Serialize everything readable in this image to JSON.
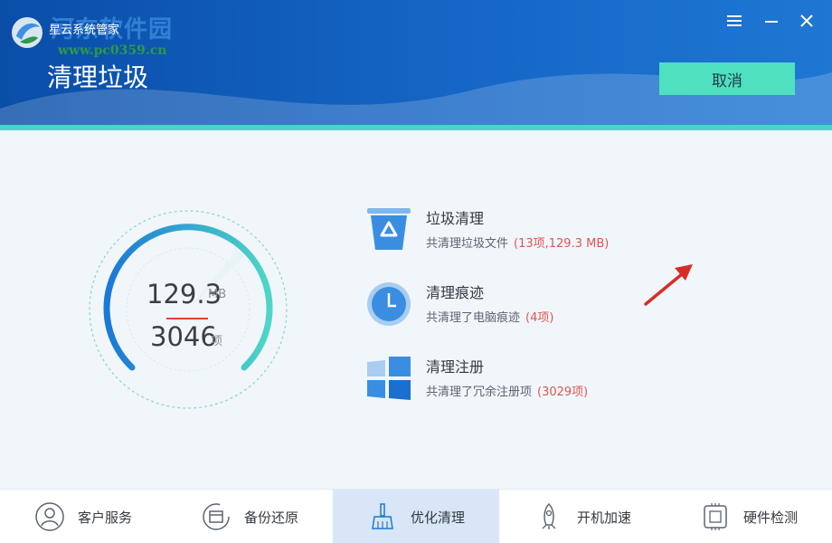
{
  "window": {
    "app_name": "星云系统管家",
    "page_title": "清理垃圾",
    "watermark": "河东软件园",
    "watermark_url": "www.pc0359.cn",
    "controls": {
      "menu": "≡",
      "minimize": "—",
      "close": "✕"
    }
  },
  "header": {
    "cancel_label": "取消"
  },
  "summary": {
    "size_value": "129.3",
    "size_unit": "MB",
    "count_value": "3046",
    "count_unit": "项"
  },
  "results": [
    {
      "title": "垃圾清理",
      "desc": "共清理垃圾文件",
      "detail": "(13项,129.3 MB)",
      "icon": "trash-bin-icon"
    },
    {
      "title": "清理痕迹",
      "desc": "共清理了电脑痕迹",
      "detail": "(4项)",
      "icon": "clock-icon"
    },
    {
      "title": "清理注册",
      "desc": "共清理了冗余注册项",
      "detail": "(3029项)",
      "icon": "registry-tiles-icon"
    }
  ],
  "bottom_nav": [
    {
      "label": "客户服务",
      "icon": "user-icon",
      "active": false
    },
    {
      "label": "备份还原",
      "icon": "backup-icon",
      "active": false
    },
    {
      "label": "优化清理",
      "icon": "broom-icon",
      "active": true
    },
    {
      "label": "开机加速",
      "icon": "rocket-icon",
      "active": false
    },
    {
      "label": "硬件检测",
      "icon": "chip-icon",
      "active": false
    }
  ],
  "colors": {
    "header_blue": "#0a4ea8",
    "accent_teal": "#44d6cb",
    "cancel_button": "#4fe0c0",
    "highlight_red": "#e0564f",
    "nav_active": "#d8e6f7"
  }
}
